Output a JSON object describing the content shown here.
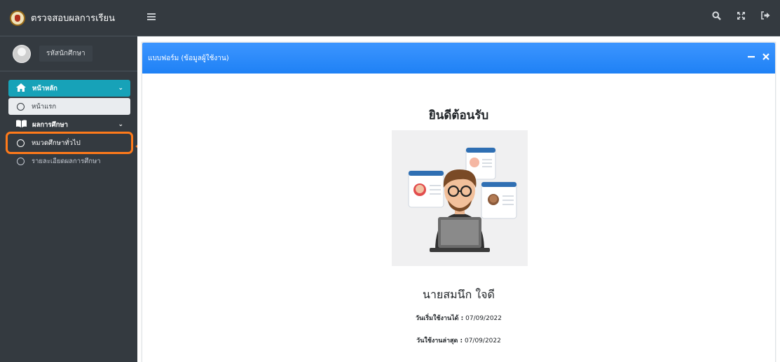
{
  "brand": {
    "title": "ตรวจสอบผลการเรียน"
  },
  "user_panel": {
    "name": "รหัสนักศึกษา"
  },
  "sidebar": {
    "items": [
      {
        "label": "หน้าหลัก",
        "icon": "home-icon"
      },
      {
        "label": "หน้าแรก",
        "icon": "circle-icon"
      },
      {
        "label": "ผลการศึกษา",
        "icon": "book-icon"
      },
      {
        "label": "หมวดศึกษาทั่วไป",
        "icon": "circle-icon"
      },
      {
        "label": "รายละเอียดผลการศึกษา",
        "icon": "circle-icon"
      }
    ]
  },
  "topbar": {
    "icons": [
      "menu-icon",
      "search-icon",
      "fullscreen-icon",
      "logout-icon"
    ]
  },
  "card": {
    "title": "แบบฟอร์ม (ข้อมูลผู้ใช้งาน)",
    "welcome": "ยินดีต้อนรับ",
    "person_name": "นายสมนึก  ใจดี",
    "start_label": "วันเริ่มใช้งานได้ :",
    "start_date": "07/09/2022",
    "last_label": "วันใช้งานล่าสุด :",
    "last_date": "07/09/2022"
  },
  "colors": {
    "sidebar_bg": "#343a40",
    "active_item": "#17a2b8",
    "card_header": "#1f81f5",
    "highlight": "#ff7a1a"
  }
}
